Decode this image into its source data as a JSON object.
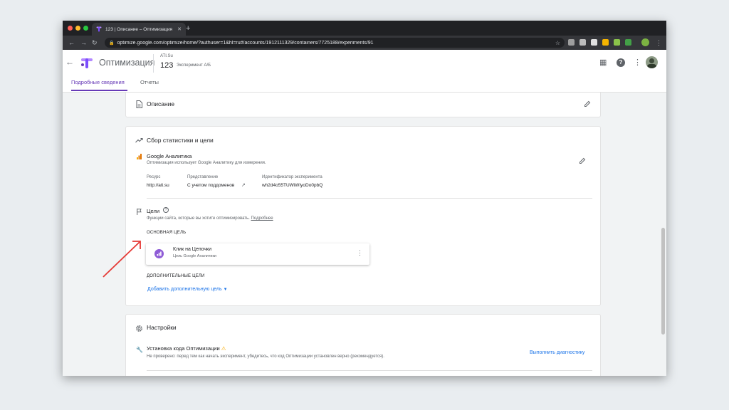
{
  "browser": {
    "tab_title": "123 | Описание – Оптимизация",
    "new_tab": "+",
    "url": "optimize.google.com/optimize/home/?authuser=1&hl=ru#/accounts/1912111329/containers/7725188/experiments/91"
  },
  "header": {
    "app_name": "Оптимизация",
    "account": "ATI.Su",
    "container": "123",
    "experiment": "Эксперимент А/Б"
  },
  "tabs": [
    {
      "label": "Подробные сведения",
      "active": true
    },
    {
      "label": "Отчеты",
      "active": false
    }
  ],
  "description_card": {
    "title": "Описание"
  },
  "stats_card": {
    "title": "Сбор статистики и цели",
    "ga": {
      "title": "Google Аналитика",
      "description": "Оптимизация использует Google Аналитику для измерения.",
      "resource_label": "Ресурс",
      "resource_value": "http://ati.su",
      "view_label": "Представление",
      "view_value": "С учетом поддоменов",
      "exp_id_label": "Идентификатор эксперимента",
      "exp_id_value": "wh2d4o55TUWiWIyoDo0pbQ"
    },
    "goals": {
      "title": "Цели",
      "description": "Функции сайта, которые вы хотите оптимизировать.",
      "more_link": "Подробнее",
      "primary_label": "ОСНОВНАЯ ЦЕЛЬ",
      "primary_goal_title": "Клик на Цепочки",
      "primary_goal_sub": "Цель Google Аналитики",
      "additional_label": "ДОПОЛНИТЕЛЬНЫЕ ЦЕЛИ",
      "add_link": "Добавить дополнительную цель"
    }
  },
  "settings_card": {
    "title": "Настройки",
    "install_title": "Установка кода Оптимизации",
    "install_desc": "Не проверено: перед тем как начать эксперимент, убедитесь, что код Оптимизации установлен верно (рекомендуется).",
    "diagnose_link": "Выполнить диагностику"
  },
  "colors": {
    "accent": "#673ab7",
    "link": "#1a73e8",
    "annotation_arrow": "#e53935"
  }
}
